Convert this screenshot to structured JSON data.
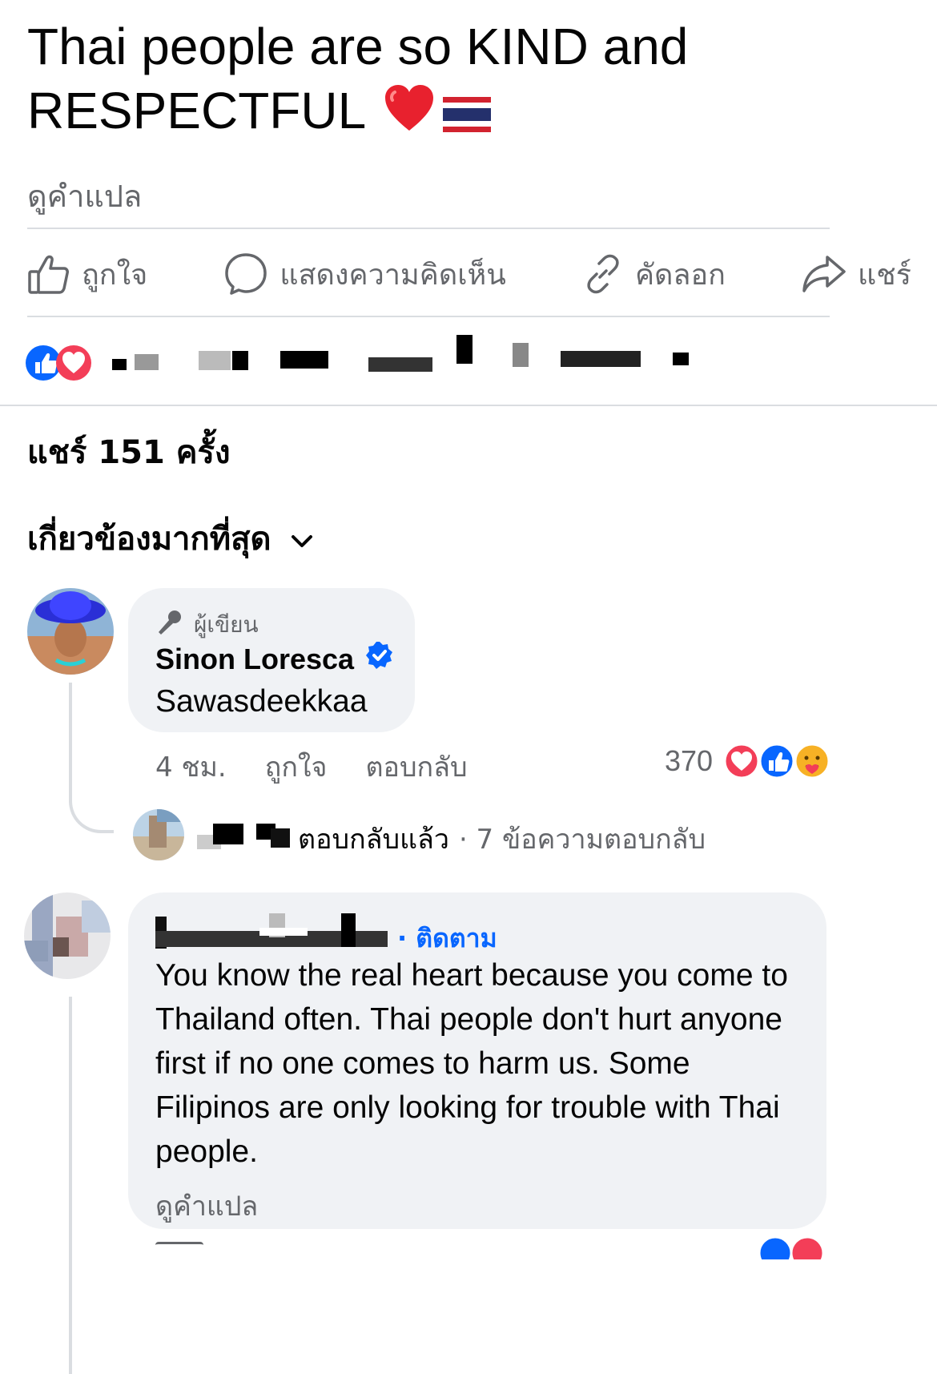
{
  "post": {
    "text_line1": "Thai people are so KIND and",
    "text_line2": "RESPECTFUL",
    "see_translation": "ดูคำแปล"
  },
  "actions": {
    "like": "ถูกใจ",
    "comment": "แสดงความคิดเห็น",
    "copy": "คัดลอก",
    "share": "แชร์"
  },
  "shares_text": "แชร์ 151 ครั้ง",
  "sort_label": "เกี่ยวข้องมากที่สุด",
  "comments": [
    {
      "badge": "ผู้เขียน",
      "name": "Sinon Loresca",
      "text": "Sawasdeekkaa",
      "time": "4 ชม.",
      "like": "ถูกใจ",
      "reply": "ตอบกลับ",
      "reaction_count": "370",
      "replies_action": "ตอบกลับแล้ว",
      "replies_count": "· 7 ข้อความตอบกลับ"
    },
    {
      "follow": "· ติดตาม",
      "text": "You know the real heart because you come to Thailand often. Thai people don't hurt anyone first if no one comes to harm us. Some Filipinos are only looking for trouble with Thai people.",
      "see_translation": "ดูคำแปล"
    }
  ],
  "colors": {
    "facebook_blue": "#0866ff",
    "grey_text": "#65676b",
    "bubble_bg": "#f0f2f5",
    "divider": "#dadde1",
    "love_red": "#f33e58"
  }
}
